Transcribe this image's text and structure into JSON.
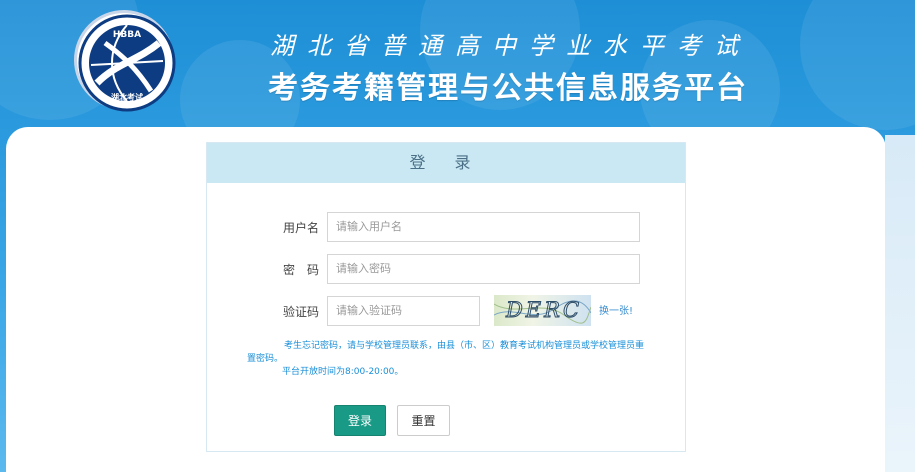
{
  "header": {
    "logo_text": "HBBA",
    "logo_subtext": "湖北考试",
    "title_line1": "湖北省普通高中学业水平考试",
    "title_line2": "考务考籍管理与公共信息服务平台"
  },
  "login": {
    "title": "登 录",
    "username_label": "用户名",
    "username_placeholder": "请输入用户名",
    "password_label": "密　码",
    "password_placeholder": "请输入密码",
    "captcha_label": "验证码",
    "captcha_placeholder": "请输入验证码",
    "captcha_text": "DERC",
    "refresh_label": "换一张!",
    "tip_line1": "考生忘记密码，请与学校管理员联系，由县（市、区）教育考试机构管理员或学校管理员重置密码。",
    "tip_line2": "平台开放时间为8:00-20:00。",
    "login_button": "登录",
    "reset_button": "重置"
  },
  "colors": {
    "header_blue": "#1e8fd6",
    "panel_head": "#c9e8f3",
    "login_button": "#199a86",
    "tip_text": "#1a8fd8"
  }
}
